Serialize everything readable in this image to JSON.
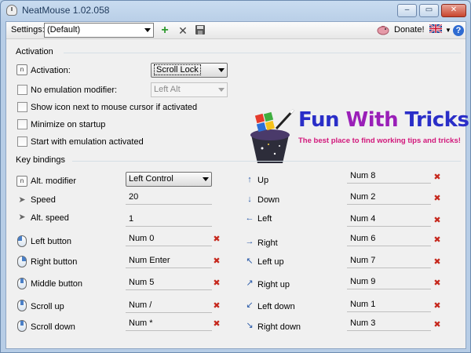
{
  "window": {
    "title": "NeatMouse 1.02.058",
    "controls": {
      "minimize": "–",
      "maximize": "▭",
      "close": "✕"
    }
  },
  "toolbar": {
    "settings_label": "Settings:",
    "settings_value": "(Default)",
    "add_icon": "plus-icon",
    "delete_icon": "x-icon",
    "save_icon": "floppy-icon",
    "donate_label": "Donate!",
    "help_label": "?"
  },
  "activation": {
    "section_title": "Activation",
    "activation_label": "Activation:",
    "activation_value": "Scroll Lock",
    "no_emulation_label": "No emulation modifier:",
    "no_emulation_value": "Left Alt",
    "show_icon_label": "Show icon next to mouse cursor if activated",
    "minimize_label": "Minimize on startup",
    "start_label": "Start with emulation activated"
  },
  "promo": {
    "title_part1": "Fun ",
    "title_part2": "With ",
    "title_part3": "Tricks",
    "subtitle": "The best place to find working tips and tricks!"
  },
  "keybindings": {
    "section_title": "Key bindings",
    "alt_modifier_label": "Alt. modifier",
    "alt_modifier_value": "Left Control",
    "speed_label": "Speed",
    "speed_value": "20",
    "alt_speed_label": "Alt. speed",
    "alt_speed_value": "1",
    "left": [
      {
        "label": "Left button",
        "value": "Num 0"
      },
      {
        "label": "Right button",
        "value": "Num Enter"
      },
      {
        "label": "Middle button",
        "value": "Num 5"
      },
      {
        "label": "Scroll up",
        "value": "Num /"
      },
      {
        "label": "Scroll down",
        "value": "Num *"
      }
    ],
    "right": [
      {
        "label": "Up",
        "value": "Num 8"
      },
      {
        "label": "Down",
        "value": "Num 2"
      },
      {
        "label": "Left",
        "value": "Num 4"
      },
      {
        "label": "Right",
        "value": "Num 6"
      },
      {
        "label": "Left up",
        "value": "Num 7"
      },
      {
        "label": "Right up",
        "value": "Num 9"
      },
      {
        "label": "Left down",
        "value": "Num 1"
      },
      {
        "label": "Right down",
        "value": "Num 3"
      }
    ],
    "remove_glyph": "✖"
  },
  "colors": {
    "accent": "#2a5aa8",
    "remove": "#c6281d",
    "promo_blue": "#2a2ec8",
    "promo_purple": "#9a1fb8",
    "promo_pink": "#d2177b"
  }
}
